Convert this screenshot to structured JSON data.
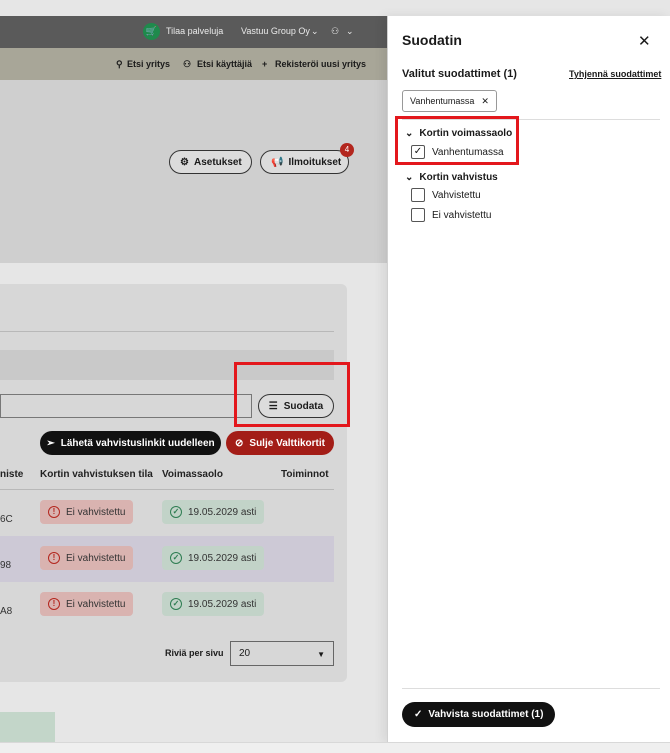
{
  "topbar": {
    "order_services": "Tilaa palveluja",
    "company": "Vastuu Group Oy",
    "company_caret": "⌄",
    "user_icon": "⚇",
    "user_caret": "⌄"
  },
  "subbar": {
    "search_company": "Etsi yritys",
    "search_users": "Etsi käyttäjiä",
    "register_company": "Rekisteröi uusi yritys"
  },
  "hero": {
    "settings": "Asetukset",
    "notifications": "Ilmoitukset",
    "notifications_count": "4"
  },
  "toolbar": {
    "filter": "Suodata",
    "resend_links": "Lähetä vahvistuslinkit uudelleen",
    "close_cards": "Sulje Valttikortit"
  },
  "table": {
    "headers": [
      "niste",
      "Kortin vahvistuksen tila",
      "Voimassaolo",
      "Toiminnot"
    ],
    "rows": [
      {
        "id": "6C",
        "status": "Ei vahvistettu",
        "validity": "19.05.2029 asti"
      },
      {
        "id": "98",
        "status": "Ei vahvistettu",
        "validity": "19.05.2029 asti"
      },
      {
        "id": "A8",
        "status": "Ei vahvistettu",
        "validity": "19.05.2029 asti"
      }
    ],
    "rows_per_page_label": "Riviä per sivu",
    "rows_per_page_value": "20"
  },
  "drawer": {
    "title": "Suodatin",
    "selected_filters": "Valitut suodattimet (1)",
    "clear_filters": "Tyhjennä suodattimet",
    "active_tag": "Vanhentumassa",
    "groups": [
      {
        "label": "Kortin voimassaolo",
        "options": [
          {
            "label": "Vanhentumassa",
            "checked": "✓"
          }
        ]
      },
      {
        "label": "Kortin vahvistus",
        "options": [
          {
            "label": "Vahvistettu",
            "checked": ""
          },
          {
            "label": "Ei vahvistettu",
            "checked": ""
          }
        ]
      }
    ],
    "confirm": "Vahvista suodattimet (1)"
  },
  "colors": {
    "accent_black": "#111111",
    "danger": "#b3261e",
    "success": "#2e7d52",
    "highlight_red": "#e3171c"
  }
}
